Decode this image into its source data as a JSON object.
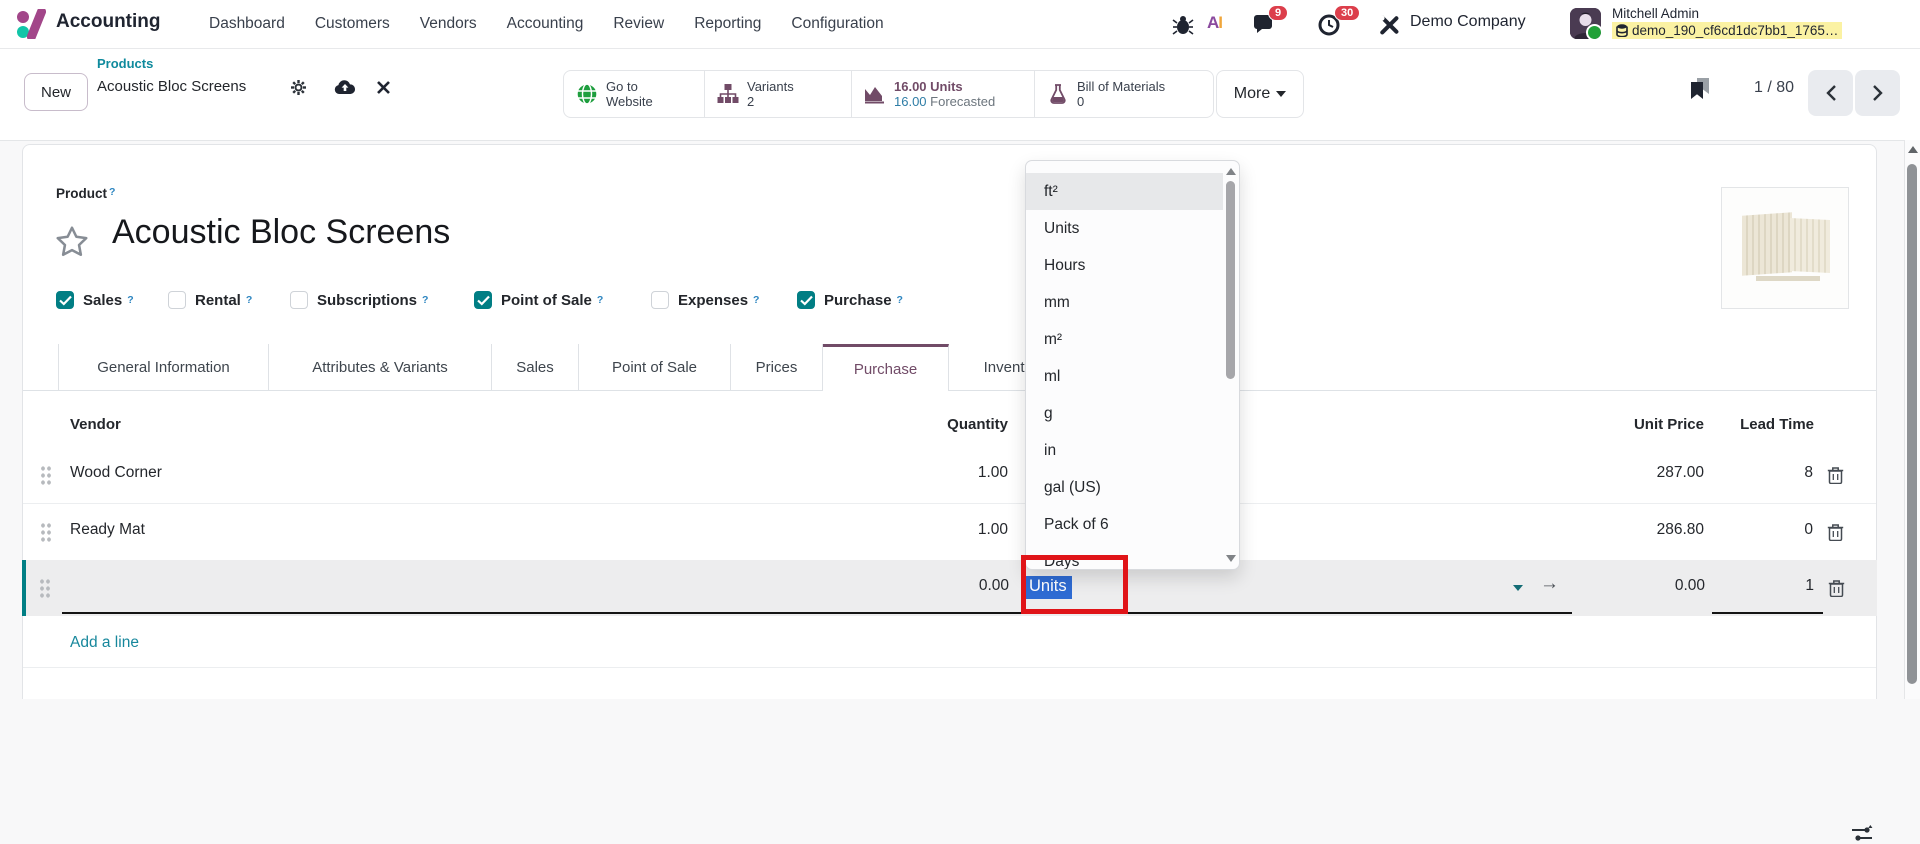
{
  "app": {
    "name": "Accounting"
  },
  "nav": {
    "items": [
      "Dashboard",
      "Customers",
      "Vendors",
      "Accounting",
      "Review",
      "Reporting",
      "Configuration"
    ]
  },
  "status": {
    "ai_a": "A",
    "ai_i": "I",
    "chat_badge": "9",
    "activity_badge": "30",
    "company": "Demo Company",
    "user": "Mitchell Admin",
    "database": "demo_190_cf6cd1dc7bb1_1765…"
  },
  "control": {
    "new_label": "New",
    "breadcrumb": {
      "parent": "Products",
      "current": "Acoustic Bloc Screens"
    },
    "pager": "1 / 80"
  },
  "smart_buttons": {
    "website": {
      "line1": "Go to",
      "line2": "Website"
    },
    "variants": {
      "label": "Variants",
      "value": "2"
    },
    "stock": {
      "line1": "16.00 Units",
      "value": "16.00",
      "label2": "Forecasted"
    },
    "bom": {
      "label": "Bill of Materials",
      "value": "0"
    },
    "more": "More"
  },
  "product": {
    "field_label": "Product",
    "help_marker": "?",
    "title": "Acoustic Bloc Screens",
    "checkboxes": [
      {
        "label": "Sales",
        "class": "checked"
      },
      {
        "label": "Rental"
      },
      {
        "label": "Subscriptions"
      },
      {
        "label": "Point of Sale",
        "class": "checked"
      },
      {
        "label": "Expenses"
      },
      {
        "label": "Purchase",
        "class": "checked"
      }
    ]
  },
  "tabs": [
    {
      "label": "General Information",
      "class": "first"
    },
    {
      "label": "Attributes & Variants"
    },
    {
      "label": "Sales"
    },
    {
      "label": "Point of Sale"
    },
    {
      "label": "Prices"
    },
    {
      "label": "Purchase",
      "class": "active"
    },
    {
      "label": "Inventory"
    }
  ],
  "vendor_table": {
    "headers": {
      "vendor": "Vendor",
      "quantity": "Quantity",
      "unit_price": "Unit Price",
      "lead_time": "Lead Time"
    },
    "rows": [
      {
        "vendor": "Wood Corner",
        "quantity": "1.00",
        "unit_price": "287.00",
        "lead_time": "8"
      },
      {
        "vendor": "Ready Mat",
        "quantity": "1.00",
        "unit_price": "286.80",
        "lead_time": "0"
      }
    ],
    "edit_row": {
      "quantity": "0.00",
      "uom": "Units",
      "unit_price": "0.00",
      "lead_time": "1"
    },
    "add_line": "Add a line"
  },
  "uom_dropdown": {
    "items": [
      {
        "label": "ft²",
        "class": "highlight"
      },
      {
        "label": "Units"
      },
      {
        "label": "Hours"
      },
      {
        "label": "mm"
      },
      {
        "label": "m²"
      },
      {
        "label": "ml"
      },
      {
        "label": "g"
      },
      {
        "label": "in"
      },
      {
        "label": "gal (US)"
      },
      {
        "label": "Pack of 6"
      },
      {
        "label": "Days"
      }
    ]
  },
  "colors": {
    "accent_purple": "#714b67",
    "teal": "#017e84",
    "link_teal": "#17879c",
    "selection_blue": "#2e6bd3",
    "annotation_red": "#e01418",
    "badge_red": "#dc3e4b",
    "forecast_blue": "#2e7da6"
  }
}
